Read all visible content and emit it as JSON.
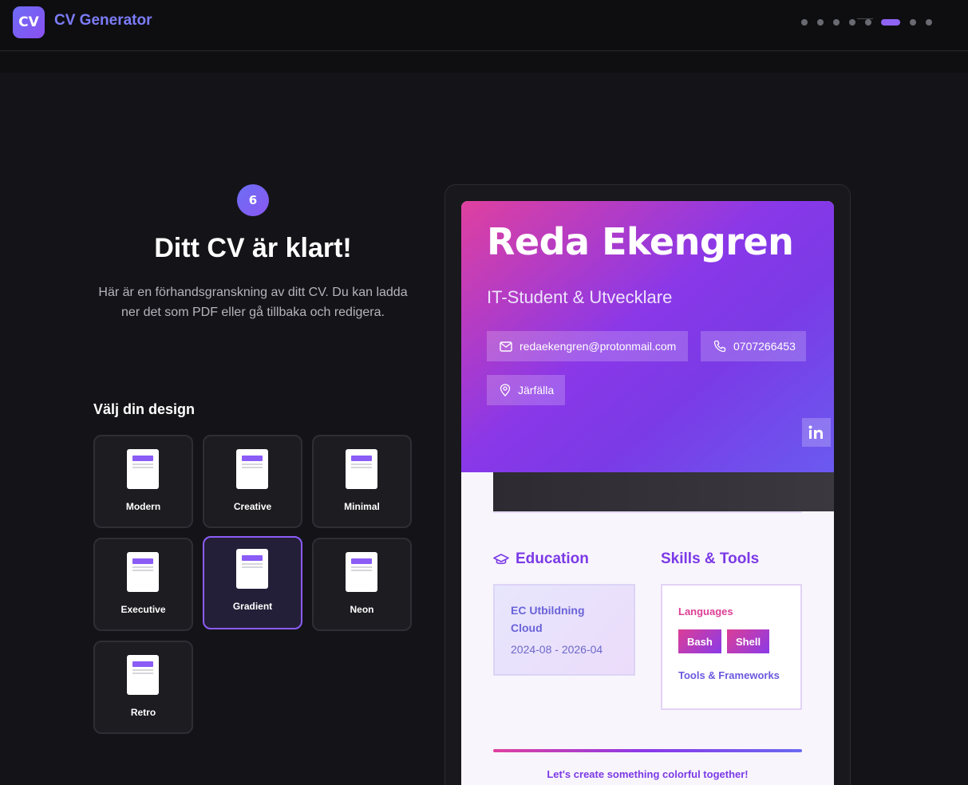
{
  "header": {
    "logo_text": "CV",
    "app_title": "CV Generator",
    "steps_total": 9,
    "steps_current": 6
  },
  "step": {
    "number": "6",
    "title": "Ditt CV är klart!",
    "description": "Här är en förhandsgranskning av ditt CV. Du kan ladda ner det som PDF eller gå tillbaka och redigera."
  },
  "designs": {
    "label": "Välj din design",
    "selected": "Gradient",
    "options": [
      "Modern",
      "Creative",
      "Minimal",
      "Executive",
      "Gradient",
      "Neon",
      "Retro"
    ]
  },
  "cv": {
    "name": "Reda Ekengren",
    "role": "IT-Student & Utvecklare",
    "email": "redaekengren@protonmail.com",
    "phone": "0707266453",
    "location": "Järfälla",
    "linkedin_icon": "linkedin-icon",
    "education": {
      "title": "Education",
      "items": [
        {
          "school": "EC Utbildning Cloud",
          "dates": "2024-08 - 2026-04"
        }
      ]
    },
    "skills": {
      "title": "Skills & Tools",
      "languages_label": "Languages",
      "languages": [
        "Bash",
        "Shell"
      ],
      "tools_label": "Tools & Frameworks"
    },
    "footer": "Let's create something colorful together!"
  },
  "colors": {
    "accent": "#8b5cf6",
    "gradient_start": "#e0409f",
    "gradient_mid": "#8a38e8",
    "gradient_end": "#6a5af0"
  }
}
